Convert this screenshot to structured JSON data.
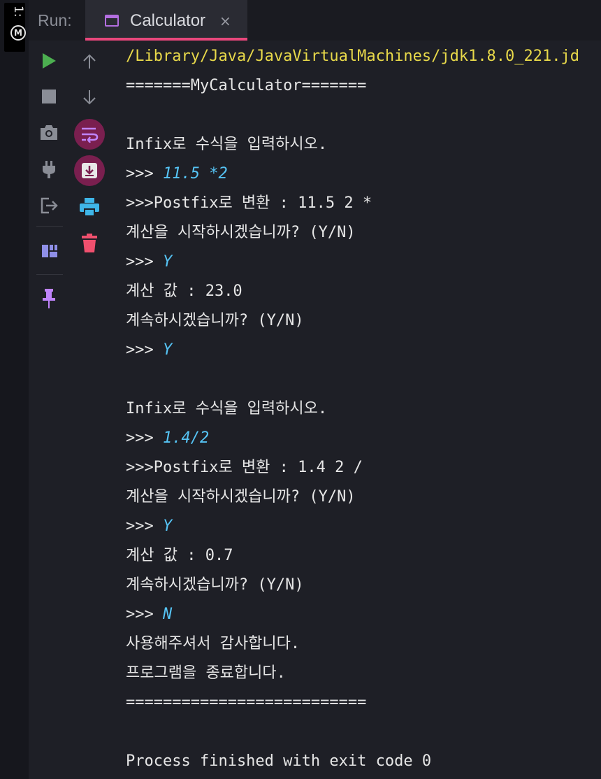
{
  "side_tag": {
    "number": "1:"
  },
  "header": {
    "run_label": "Run:",
    "tab_title": "Calculator",
    "tab_close": "×"
  },
  "toolbar": {
    "items": [
      {
        "name": "run-icon",
        "color": "#4caf50"
      },
      {
        "name": "up-arrow-icon",
        "color": "#8a8d96"
      },
      {
        "name": "stop-icon",
        "color": "#8a8d96"
      },
      {
        "name": "down-arrow-icon",
        "color": "#8a8d96"
      },
      {
        "name": "camera-icon",
        "color": "#8a8d96"
      },
      {
        "name": "soft-wrap-icon",
        "color": "#c084fc"
      },
      {
        "name": "plug-icon",
        "color": "#8a8d96"
      },
      {
        "name": "scroll-to-end-icon",
        "color": "#e8e8e8"
      },
      {
        "name": "exit-icon",
        "color": "#8a8d96"
      },
      {
        "name": "print-icon",
        "color": "#3fb6e8"
      },
      {
        "name": "layout-icon",
        "color": "#8f8fe8"
      },
      {
        "name": "trash-icon",
        "color": "#f0506e"
      },
      {
        "name": "pin-icon",
        "color": "#c084fc"
      }
    ]
  },
  "console": {
    "lines": [
      {
        "type": "sys",
        "text": "/Library/Java/JavaVirtualMachines/jdk1.8.0_221.jd"
      },
      {
        "type": "out",
        "text": "=======MyCalculator======="
      },
      {
        "type": "blank",
        "text": ""
      },
      {
        "type": "out",
        "text": "Infix로 수식을 입력하시오."
      },
      {
        "type": "in",
        "prompt": ">>> ",
        "text": "11.5 *2"
      },
      {
        "type": "out",
        "text": ">>>Postfix로 변환 : 11.5 2 *"
      },
      {
        "type": "out",
        "text": "계산을 시작하시겠습니까? (Y/N)"
      },
      {
        "type": "in",
        "prompt": ">>> ",
        "text": "Y"
      },
      {
        "type": "out",
        "text": "계산 값 : 23.0"
      },
      {
        "type": "out",
        "text": "계속하시겠습니까? (Y/N)"
      },
      {
        "type": "in",
        "prompt": ">>> ",
        "text": "Y"
      },
      {
        "type": "blank",
        "text": ""
      },
      {
        "type": "out",
        "text": "Infix로 수식을 입력하시오."
      },
      {
        "type": "in",
        "prompt": ">>> ",
        "text": "1.4/2"
      },
      {
        "type": "out",
        "text": ">>>Postfix로 변환 : 1.4 2 /"
      },
      {
        "type": "out",
        "text": "계산을 시작하시겠습니까? (Y/N)"
      },
      {
        "type": "in",
        "prompt": ">>> ",
        "text": "Y"
      },
      {
        "type": "out",
        "text": "계산 값 : 0.7"
      },
      {
        "type": "out",
        "text": "계속하시겠습니까? (Y/N)"
      },
      {
        "type": "in",
        "prompt": ">>> ",
        "text": "N"
      },
      {
        "type": "out",
        "text": "사용해주셔서 감사합니다."
      },
      {
        "type": "out",
        "text": "프로그램을 종료합니다."
      },
      {
        "type": "out",
        "text": "=========================="
      },
      {
        "type": "blank",
        "text": ""
      },
      {
        "type": "out",
        "text": "Process finished with exit code 0"
      }
    ]
  }
}
